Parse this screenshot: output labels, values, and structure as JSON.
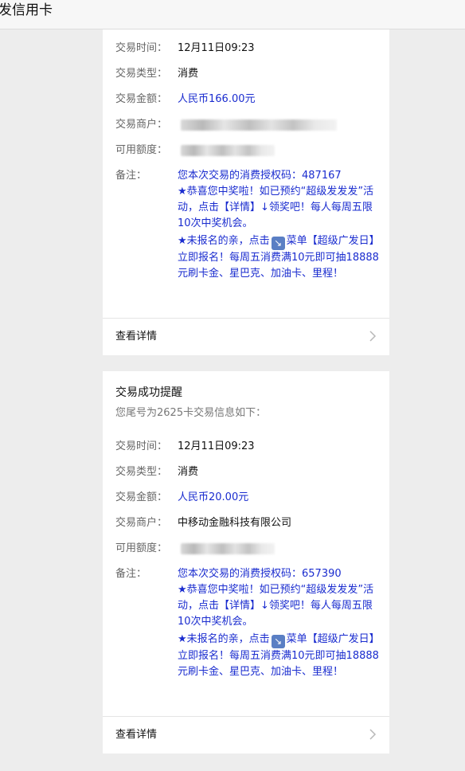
{
  "app": {
    "title": "发信用卡"
  },
  "labels": {
    "time": "交易时间：",
    "type": "交易类型：",
    "amount": "交易金额：",
    "merchant": "交易商户：",
    "limit": "可用额度：",
    "remark": "备注：",
    "view_details": "查看详情"
  },
  "icons": {
    "remark_arrow": "arrow-down-right-icon",
    "chevron": "chevron-right-icon"
  },
  "colors": {
    "link_blue": "#1a2ccf",
    "background": "#ededed",
    "card": "#ffffff"
  },
  "cards": [
    {
      "time": "12月11日09:23",
      "type": "消费",
      "amount": "人民币166.00元",
      "remark": {
        "code_line": "您本次交易的消费授权码：487167",
        "promo": "★恭喜您中奖啦！如已预约“超级发发发”活动，点击【详情】↓领奖吧！每人每周五限10次中奖机会。",
        "signup_before": "★未报名的亲，点击",
        "signup_after": "菜单【超级广发日】立即报名！每周五消费满10元即可抽18888元刷卡金、星巴克、加油卡、里程！"
      }
    },
    {
      "header_title": "交易成功提醒",
      "header_sub": "您尾号为2625卡交易信息如下：",
      "time": "12月11日09:23",
      "type": "消费",
      "amount": "人民币20.00元",
      "merchant": "中移动金融科技有限公司",
      "remark": {
        "code_line": "您本次交易的消费授权码：657390",
        "promo": "★恭喜您中奖啦！如已预约“超级发发发”活动，点击【详情】↓领奖吧！每人每周五限10次中奖机会。",
        "signup_before": "★未报名的亲，点击",
        "signup_after": "菜单【超级广发日】立即报名！每周五消费满10元即可抽18888元刷卡金、星巴克、加油卡、里程！"
      }
    }
  ]
}
